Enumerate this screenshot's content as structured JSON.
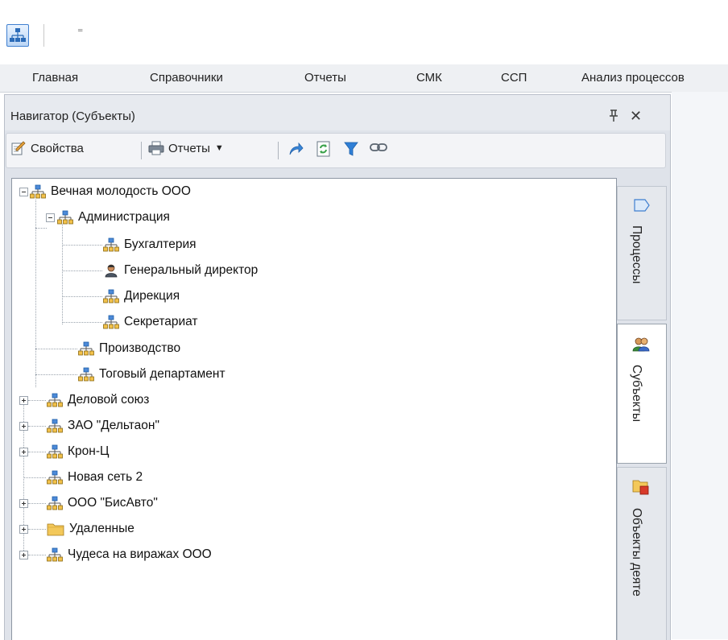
{
  "quick_access": {
    "more_glyph": "₌"
  },
  "ribbon_tabs": [
    "Главная",
    "Справочники",
    "Отчеты",
    "СМК",
    "ССП",
    "Анализ процессов"
  ],
  "panel": {
    "title": "Навигатор (Субъекты)",
    "toolbar": {
      "properties": "Свойства",
      "reports": "Отчеты"
    }
  },
  "tree": [
    {
      "label": "Вечная молодость ООО",
      "icon": "org-icon",
      "state": "expanded"
    },
    {
      "label": "Администрация",
      "icon": "org-icon",
      "state": "expanded"
    },
    {
      "label": "Бухгалтерия",
      "icon": "org-icon"
    },
    {
      "label": "Генеральный директор",
      "icon": "person-icon"
    },
    {
      "label": "Дирекция",
      "icon": "org-icon"
    },
    {
      "label": "Секретариат",
      "icon": "org-icon"
    },
    {
      "label": "Производство",
      "icon": "org-icon"
    },
    {
      "label": "Тоговый департамент",
      "icon": "org-icon"
    },
    {
      "label": "Деловой союз",
      "icon": "org-icon",
      "state": "collapsed"
    },
    {
      "label": "ЗАО \"Дельтаон\"",
      "icon": "org-icon",
      "state": "collapsed"
    },
    {
      "label": "Крон-Ц",
      "icon": "org-icon",
      "state": "collapsed"
    },
    {
      "label": "Новая сеть 2",
      "icon": "org-icon"
    },
    {
      "label": "ООО \"БисАвто\"",
      "icon": "org-icon",
      "state": "collapsed"
    },
    {
      "label": "Удаленные",
      "icon": "folder-icon",
      "state": "collapsed"
    },
    {
      "label": "Чудеса на виражах ООО",
      "icon": "org-icon",
      "state": "collapsed"
    }
  ],
  "side_tabs": [
    {
      "label": "Процессы",
      "icon": "process-icon"
    },
    {
      "label": "Субъекты",
      "icon": "subjects-icon",
      "active": true
    },
    {
      "label": "Объекты деяте",
      "icon": "objects-icon"
    }
  ]
}
